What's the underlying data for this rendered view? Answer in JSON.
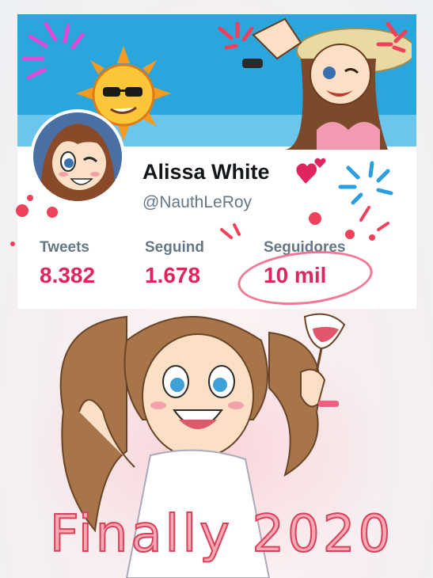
{
  "profile": {
    "name": "Alissa White",
    "handle": "@NauthLeRoy",
    "verified_heart_icon": "heart-icon"
  },
  "stats": [
    {
      "label": "Tweets",
      "value": "8.382"
    },
    {
      "label": "Seguind",
      "value": "1.678"
    },
    {
      "label": "Seguidores",
      "value": "10 mil"
    }
  ],
  "caption": "Finally 2020",
  "colors": {
    "accent": "#e0245e",
    "label": "#657786",
    "banner": "#2aa6dc",
    "circle": "#f06080"
  }
}
